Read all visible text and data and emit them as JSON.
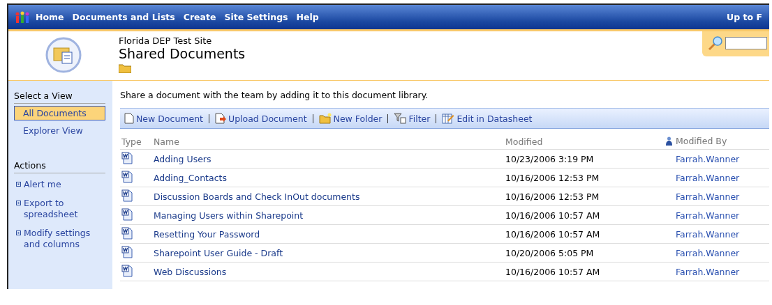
{
  "top_nav": {
    "items": [
      "Home",
      "Documents and Lists",
      "Create",
      "Site Settings",
      "Help"
    ],
    "right_link": "Up to F"
  },
  "header": {
    "site_title": "Florida DEP Test Site",
    "page_title": "Shared Documents"
  },
  "sidebar": {
    "views_heading": "Select a View",
    "views": [
      {
        "label": "All Documents",
        "selected": true
      },
      {
        "label": "Explorer View",
        "selected": false
      }
    ],
    "actions_heading": "Actions",
    "actions": [
      "Alert me",
      "Export to spreadsheet",
      "Modify settings and columns"
    ]
  },
  "description": "Share a document with the team by adding it to this document library.",
  "toolbar": [
    {
      "kind": "new",
      "label": "New Document"
    },
    {
      "kind": "upload",
      "label": "Upload Document"
    },
    {
      "kind": "folder",
      "label": "New Folder"
    },
    {
      "kind": "filter",
      "label": "Filter"
    },
    {
      "kind": "datasheet",
      "label": "Edit in Datasheet"
    }
  ],
  "table": {
    "columns": [
      "Type",
      "Name",
      "Modified",
      "Modified By"
    ],
    "rows": [
      {
        "name": "Adding Users",
        "modified": "10/23/2006 3:19 PM",
        "modified_by": "Farrah.Wanner"
      },
      {
        "name": "Adding_Contacts",
        "modified": "10/16/2006 12:53 PM",
        "modified_by": "Farrah.Wanner"
      },
      {
        "name": "Discussion Boards and Check InOut documents",
        "modified": "10/16/2006 12:53 PM",
        "modified_by": "Farrah.Wanner"
      },
      {
        "name": "Managing Users within Sharepoint",
        "modified": "10/16/2006 10:57 AM",
        "modified_by": "Farrah.Wanner"
      },
      {
        "name": "Resetting Your Password",
        "modified": "10/16/2006 10:57 AM",
        "modified_by": "Farrah.Wanner"
      },
      {
        "name": "Sharepoint User Guide - Draft",
        "modified": "10/20/2006 5:05 PM",
        "modified_by": "Farrah.Wanner"
      },
      {
        "name": "Web Discussions",
        "modified": "10/16/2006 10:57 AM",
        "modified_by": "Farrah.Wanner"
      }
    ]
  }
}
